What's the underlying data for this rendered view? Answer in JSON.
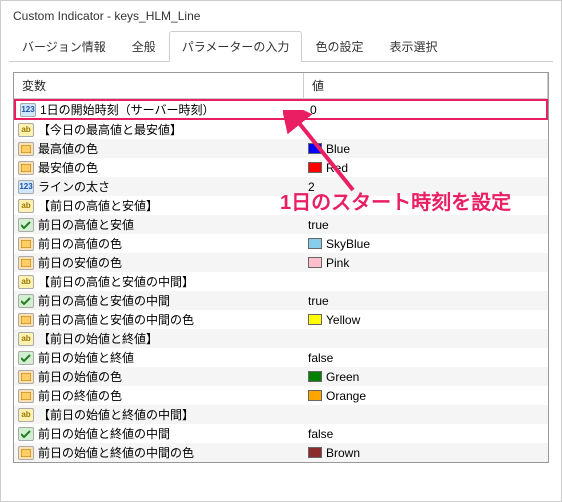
{
  "window": {
    "title": "Custom Indicator - keys_HLM_Line"
  },
  "tabs": [
    {
      "label": "バージョン情報"
    },
    {
      "label": "全般"
    },
    {
      "label": "パラメーターの入力"
    },
    {
      "label": "色の設定"
    },
    {
      "label": "表示選択"
    }
  ],
  "active_tab": 2,
  "columns": {
    "variable": "変数",
    "value": "値"
  },
  "rows": [
    {
      "icon": "num",
      "name": "1日の開始時刻（サーバー時刻）",
      "value": "0",
      "highlight": true
    },
    {
      "icon": "str",
      "name": "【今日の最高値と最安値】",
      "value": ""
    },
    {
      "icon": "col",
      "name": "最高値の色",
      "value": "Blue",
      "color": "#0000ff"
    },
    {
      "icon": "col",
      "name": "最安値の色",
      "value": "Red",
      "color": "#ff0000"
    },
    {
      "icon": "num",
      "name": "ラインの太さ",
      "value": "2"
    },
    {
      "icon": "str",
      "name": "【前日の高値と安値】",
      "value": ""
    },
    {
      "icon": "bool",
      "name": "前日の高値と安値",
      "value": "true"
    },
    {
      "icon": "col",
      "name": "前日の高値の色",
      "value": "SkyBlue",
      "color": "#87ceeb"
    },
    {
      "icon": "col",
      "name": "前日の安値の色",
      "value": "Pink",
      "color": "#ffc0cb"
    },
    {
      "icon": "str",
      "name": "【前日の高値と安値の中間】",
      "value": ""
    },
    {
      "icon": "bool",
      "name": "前日の高値と安値の中間",
      "value": "true"
    },
    {
      "icon": "col",
      "name": "前日の高値と安値の中間の色",
      "value": "Yellow",
      "color": "#ffff00"
    },
    {
      "icon": "str",
      "name": "【前日の始値と終値】",
      "value": ""
    },
    {
      "icon": "bool",
      "name": "前日の始値と終値",
      "value": "false"
    },
    {
      "icon": "col",
      "name": "前日の始値の色",
      "value": "Green",
      "color": "#008000"
    },
    {
      "icon": "col",
      "name": "前日の終値の色",
      "value": "Orange",
      "color": "#ffa500"
    },
    {
      "icon": "str",
      "name": "【前日の始値と終値の中間】",
      "value": ""
    },
    {
      "icon": "bool",
      "name": "前日の始値と終値の中間",
      "value": "false"
    },
    {
      "icon": "col",
      "name": "前日の始値と終値の中間の色",
      "value": "Brown",
      "color": "#8b2b2b"
    }
  ],
  "annotation": {
    "text": "1日のスタート時刻を設定"
  }
}
